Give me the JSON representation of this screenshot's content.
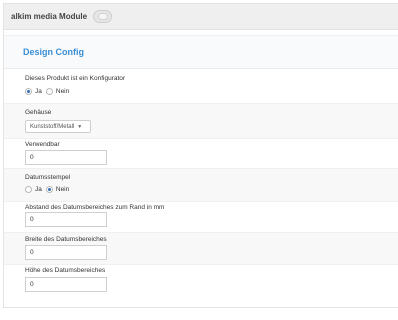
{
  "module": {
    "title": "alkim media Module"
  },
  "section": {
    "title": "Design Config"
  },
  "konfigurator": {
    "label": "Dieses Produkt ist ein Konfigurator",
    "options": [
      "Ja",
      "Nein"
    ],
    "selected": "Ja"
  },
  "gehaeuse": {
    "label": "Gehäuse",
    "value": "Kunststoff/Metall"
  },
  "verwendbar": {
    "label": "Verwendbar",
    "value": "0"
  },
  "datumsstempel": {
    "label": "Datumsstempel",
    "options": [
      "Ja",
      "Nein"
    ],
    "selected": "Nein"
  },
  "abstand": {
    "label": "Abstand des Datumsbereiches zum Rand in mm",
    "value": "0"
  },
  "breite": {
    "label": "Breite des Datumsbereiches",
    "value": "0"
  },
  "hoehe": {
    "label": "Höhe des Datumsbereiches",
    "value": "0"
  }
}
